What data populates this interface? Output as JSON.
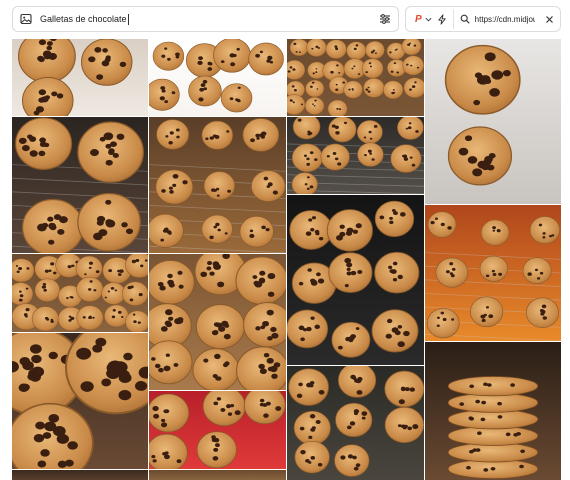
{
  "search": {
    "query": "Galletas de chocolate",
    "image_icon": "image-icon",
    "filter_icon": "sliders-icon"
  },
  "source": {
    "engine_logo": "P",
    "url": "https://cdn.midjou",
    "icons": [
      "chevron-down-icon",
      "bolt-icon",
      "search-icon",
      "close-icon"
    ]
  },
  "results": {
    "alt_label": "Galletas de chocolate"
  },
  "colors": {
    "engine_accent": "#e2492f",
    "border": "#dcdcdc"
  }
}
